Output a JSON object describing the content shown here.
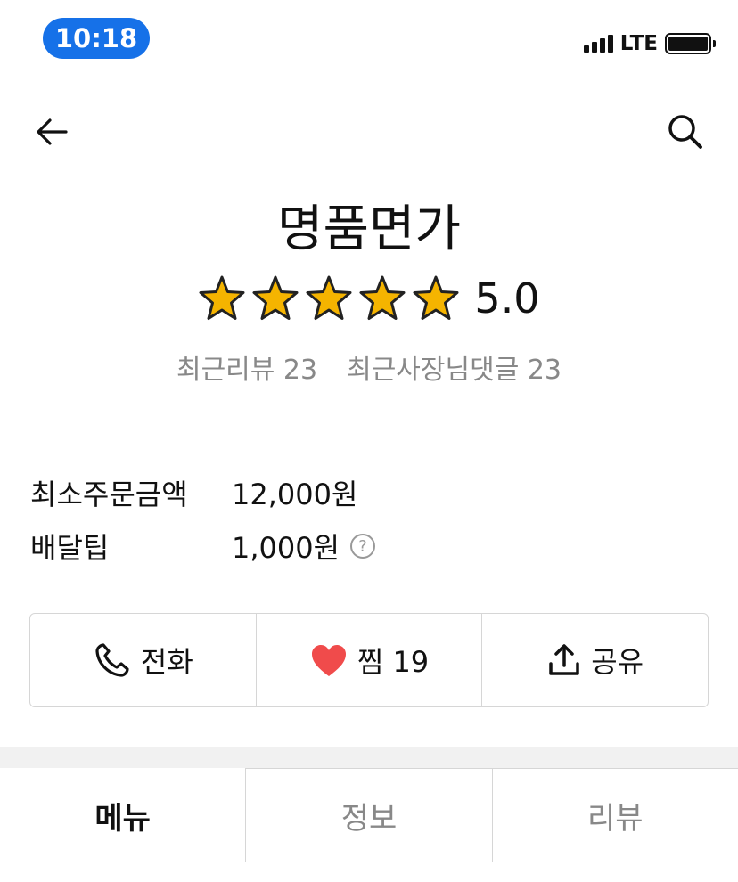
{
  "status_bar": {
    "time": "10:18",
    "network": "LTE"
  },
  "store": {
    "name": "명품면가",
    "rating": "5.0",
    "stars": 5,
    "recent_reviews_label": "최근리뷰 23",
    "recent_owner_replies_label": "최근사장님댓글 23"
  },
  "info": {
    "min_order_label": "최소주문금액",
    "min_order_value": "12,000원",
    "delivery_tip_label": "배달팁",
    "delivery_tip_value": "1,000원",
    "help_symbol": "?"
  },
  "actions": {
    "call_label": "전화",
    "like_label": "찜 19",
    "share_label": "공유"
  },
  "tabs": [
    {
      "label": "메뉴",
      "active": true
    },
    {
      "label": "정보",
      "active": false
    },
    {
      "label": "리뷰",
      "active": false
    }
  ],
  "icons": [
    "back-arrow-icon",
    "search-icon",
    "star-icon",
    "phone-icon",
    "heart-icon",
    "share-icon",
    "help-icon"
  ],
  "colors": {
    "accent": "#1671e8",
    "star": "#f5b400",
    "heart": "#f04b4b"
  }
}
